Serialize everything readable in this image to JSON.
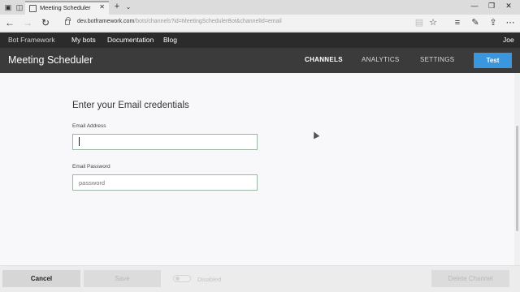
{
  "browser": {
    "tab_title": "Meeting Scheduler",
    "tab_close": "✕",
    "new_tab": "+",
    "tab_menu": "⌄",
    "window_controls": {
      "minimize": "—",
      "maximize": "❐",
      "close": "✕"
    },
    "url_host": "dev.botframework.com",
    "url_path": "/bots/channels?id=MeetingSchedulerBot&channelId=email",
    "icons": [
      "back-icon",
      "forward-icon",
      "refresh-icon",
      "lock-icon",
      "reading-view-icon",
      "favorite-star-icon",
      "hub-icon",
      "web-note-icon",
      "share-icon",
      "more-icon"
    ]
  },
  "site_nav": {
    "brand": "Bot Framework",
    "links": [
      "My bots",
      "Documentation",
      "Blog"
    ],
    "user": "Joe"
  },
  "bot_header": {
    "title": "Meeting Scheduler",
    "tabs": [
      "CHANNELS",
      "ANALYTICS",
      "SETTINGS"
    ],
    "active_tab": "CHANNELS",
    "test_label": "Test"
  },
  "form": {
    "title": "Enter your Email credentials",
    "email_label": "Email Address",
    "email_value": "",
    "password_label": "Email Password",
    "password_placeholder": "password"
  },
  "footer": {
    "cancel": "Cancel",
    "save": "Save",
    "toggle_label": "Disabled",
    "delete": "Delete Channel"
  },
  "colors": {
    "accent": "#3a96dd",
    "nav_bg": "#2b2b2b",
    "header_bg": "#3b3b3b"
  }
}
